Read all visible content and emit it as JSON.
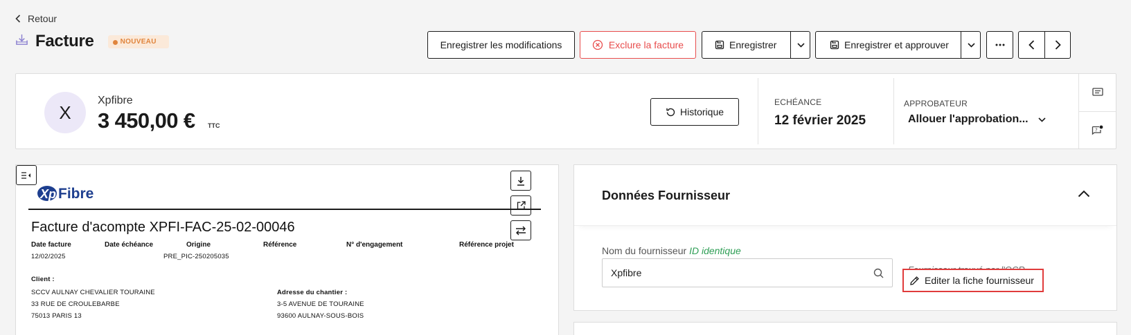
{
  "nav": {
    "back_label": "Retour"
  },
  "header": {
    "title": "Facture",
    "status_badge": "NOUVEAU",
    "status_color": "#e0843c"
  },
  "toolbar": {
    "save_changes_label": "Enregistrer les modifications",
    "exclude_label": "Exclure la facture",
    "save_label": "Enregistrer",
    "save_approve_label": "Enregistrer et approuver",
    "more_icon": "ellipsis-icon",
    "prev_icon": "chevron-left-icon",
    "next_icon": "chevron-right-icon",
    "danger_color": "#e84c4c"
  },
  "summary": {
    "avatar_initial": "X",
    "vendor": "Xpfibre",
    "amount": "3 450,00 €",
    "amount_suffix": "TTC",
    "history_label": "Historique",
    "due_label": "ECHÉANCE",
    "due_value": "12 février 2025",
    "approver_label": "APPROBATEUR",
    "approver_value": "Allouer l'approbation..."
  },
  "document": {
    "logo_text": "XpFibre",
    "title": "Facture d'acompte XPFI-FAC-25-02-00046",
    "columns": [
      "Date facture",
      "Date échéance",
      "Origine",
      "Référence",
      "N° d'engagement",
      "Référence projet"
    ],
    "row": {
      "date_facture": "12/02/2025",
      "origine": "PRE_PIC-250205035"
    },
    "client_label": "Client :",
    "client_lines": [
      "SCCV AULNAY CHEVALIER TOURAINE",
      "33 RUE DE CROULEBARBE",
      "75013  PARIS 13"
    ],
    "site_label": "Adresse du chantier :",
    "site_lines": [
      "3-5 AVENUE DE TOURAINE",
      "93600 AULNAY-SOUS-BOIS"
    ]
  },
  "supplier_panel": {
    "title": "Données Fournisseur",
    "field_label": "Nom du fournisseur",
    "field_status": "ID identique",
    "field_value": "Xpfibre",
    "ocr_note": "Fournisseur trouvé par l'OCR",
    "edit_label": "Editer la fiche fournisseur",
    "ok_color": "#2e9e55",
    "highlight_color": "#e03b3b"
  }
}
